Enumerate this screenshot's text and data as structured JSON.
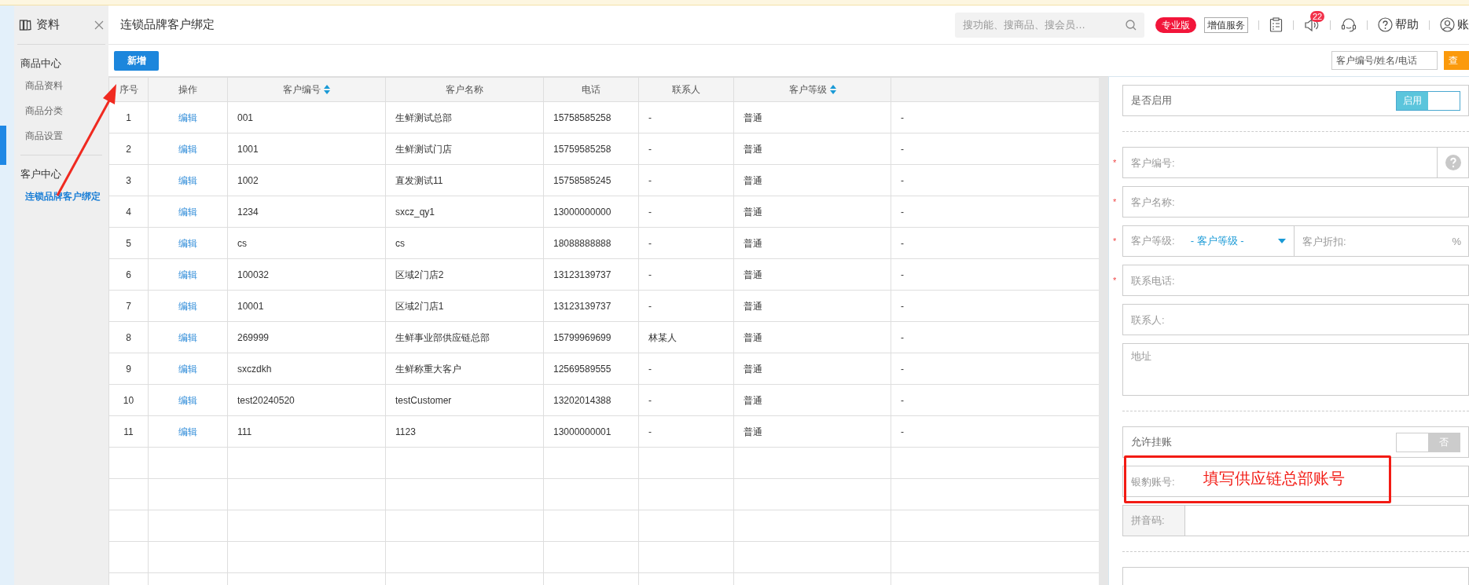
{
  "sidebar": {
    "title": "资料",
    "groups": [
      {
        "title": "商品中心",
        "items": [
          {
            "label": "商品资料",
            "selected": false
          },
          {
            "label": "商品分类",
            "selected": false
          },
          {
            "label": "商品设置",
            "selected": false
          }
        ]
      },
      {
        "title": "客户中心",
        "items": [
          {
            "label": "连锁品牌客户绑定",
            "selected": true
          }
        ]
      }
    ]
  },
  "header": {
    "title": "连锁品牌客户绑定",
    "search": {
      "placeholder": "搜功能、搜商品、搜会员…"
    },
    "edition_badge": "专业版",
    "service_button": "增值服务",
    "notification_count": "22",
    "help": "帮助",
    "account": "账"
  },
  "toolbar": {
    "add_button": "新增",
    "query": {
      "placeholder": "客户编号/姓名/电话"
    },
    "query_button": "查"
  },
  "table": {
    "columns": [
      {
        "label": "序号",
        "sortable": false
      },
      {
        "label": "操作",
        "sortable": false
      },
      {
        "label": "客户编号",
        "sortable": true
      },
      {
        "label": "客户名称",
        "sortable": false
      },
      {
        "label": "电话",
        "sortable": false
      },
      {
        "label": "联系人",
        "sortable": false
      },
      {
        "label": "客户等级",
        "sortable": true
      },
      {
        "sortable": false
      }
    ],
    "rows": [
      [
        "1",
        "编辑",
        "001",
        "生鲜测试总部",
        "15758585258",
        "-",
        "普通",
        "-"
      ],
      [
        "2",
        "编辑",
        "1001",
        "生鲜测试门店",
        "15759585258",
        "-",
        "普通",
        "-"
      ],
      [
        "3",
        "编辑",
        "1002",
        "直发测试11",
        "15758585245",
        "-",
        "普通",
        "-"
      ],
      [
        "4",
        "编辑",
        "1234",
        "sxcz_qy1",
        "13000000000",
        "-",
        "普通",
        "-"
      ],
      [
        "5",
        "编辑",
        "cs",
        "cs",
        "18088888888",
        "-",
        "普通",
        "-"
      ],
      [
        "6",
        "编辑",
        "100032",
        "区域2门店2",
        "13123139737",
        "-",
        "普通",
        "-"
      ],
      [
        "7",
        "编辑",
        "10001",
        "区域2门店1",
        "13123139737",
        "-",
        "普通",
        "-"
      ],
      [
        "8",
        "编辑",
        "269999",
        "生鲜事业部供应链总部",
        "15799969699",
        "林某人",
        "普通",
        "-"
      ],
      [
        "9",
        "编辑",
        "sxczdkh",
        "生鲜称重大客户",
        "12569589555",
        "-",
        "普通",
        "-"
      ],
      [
        "10",
        "编辑",
        "test20240520",
        "testCustomer",
        "13202014388",
        "-",
        "普通",
        "-"
      ],
      [
        "11",
        "编辑",
        "111",
        "1123",
        "13000000001",
        "-",
        "普通",
        "-"
      ]
    ]
  },
  "form": {
    "sections": [
      [
        {
          "kind": "toggle",
          "label": "是否启用",
          "on": true,
          "state_text": "启用"
        }
      ],
      [
        {
          "kind": "input",
          "placeholder": "客户编号:",
          "required_mark": "*",
          "help": true
        },
        {
          "kind": "input",
          "placeholder": "客户名称:",
          "required_mark": "*",
          "help": false
        },
        {
          "kind": "select_pair",
          "label": "客户等级:",
          "value": "- 客户等级 -",
          "required_mark": "*",
          "second_placeholder": "客户折扣:",
          "suffix": "%"
        },
        {
          "kind": "input",
          "placeholder": "联系电话:",
          "required_mark": "*",
          "help": false
        },
        {
          "kind": "input",
          "placeholder": "联系人:",
          "help": false
        },
        {
          "kind": "textarea",
          "placeholder": "地址"
        }
      ],
      [
        {
          "kind": "toggle",
          "label": "允许挂账",
          "on": false,
          "state_text": "否"
        },
        {
          "kind": "input",
          "placeholder": "银豹账号:",
          "help": false
        },
        {
          "kind": "addon",
          "label": "拼音码:"
        }
      ],
      [
        {
          "kind": "blank"
        }
      ]
    ]
  },
  "annotation": {
    "text": "填写供应链总部账号"
  }
}
